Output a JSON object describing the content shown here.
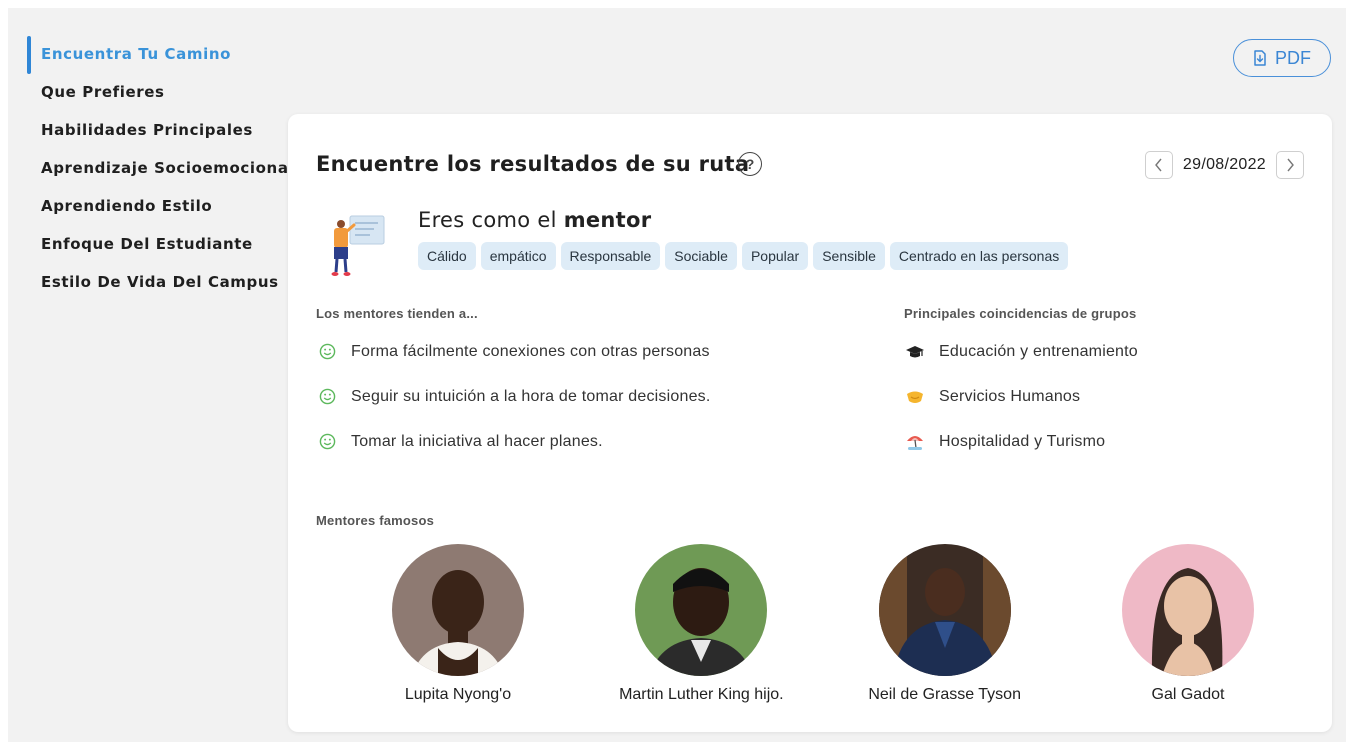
{
  "sidebar": {
    "items": [
      {
        "label": "Encuentra Tu Camino",
        "active": true
      },
      {
        "label": "Que Prefieres"
      },
      {
        "label": "Habilidades Principales"
      },
      {
        "label": "Aprendizaje Socioemocional"
      },
      {
        "label": "Aprendiendo Estilo"
      },
      {
        "label": "Enfoque Del Estudiante"
      },
      {
        "label": "Estilo De Vida Del Campus"
      }
    ]
  },
  "toolbar": {
    "pdf_label": "PDF"
  },
  "card": {
    "title": "Encuentre los resultados de su ruta",
    "help_icon": "?",
    "date": "29/08/2022"
  },
  "profile": {
    "prefix": "Eres como el ",
    "type": "mentor",
    "tags": [
      "Cálido",
      "empático",
      "Responsable",
      "Sociable",
      "Popular",
      "Sensible",
      "Centrado en las personas"
    ]
  },
  "tendencies": {
    "label": "Los mentores tienden a...",
    "items": [
      "Forma fácilmente conexiones con otras personas",
      "Seguir su intuición a la hora de tomar decisiones.",
      "Tomar la iniciativa al hacer planes."
    ],
    "icon": "smiley-icon"
  },
  "groups": {
    "label": "Principales coincidencias de grupos",
    "items": [
      {
        "label": "Educación y entrenamiento",
        "icon": "graduation-cap-icon"
      },
      {
        "label": "Servicios Humanos",
        "icon": "handshake-icon"
      },
      {
        "label": "Hospitalidad y Turismo",
        "icon": "beach-umbrella-icon"
      }
    ]
  },
  "famous": {
    "label": "Mentores famosos",
    "people": [
      {
        "name": "Lupita Nyong'o"
      },
      {
        "name": "Martin Luther King hijo."
      },
      {
        "name": "Neil de Grasse Tyson"
      },
      {
        "name": "Gal Gadot"
      }
    ]
  },
  "colors": {
    "accent": "#3a93d9",
    "tag_bg": "#deecf7",
    "smiley": "#5cb85c"
  }
}
